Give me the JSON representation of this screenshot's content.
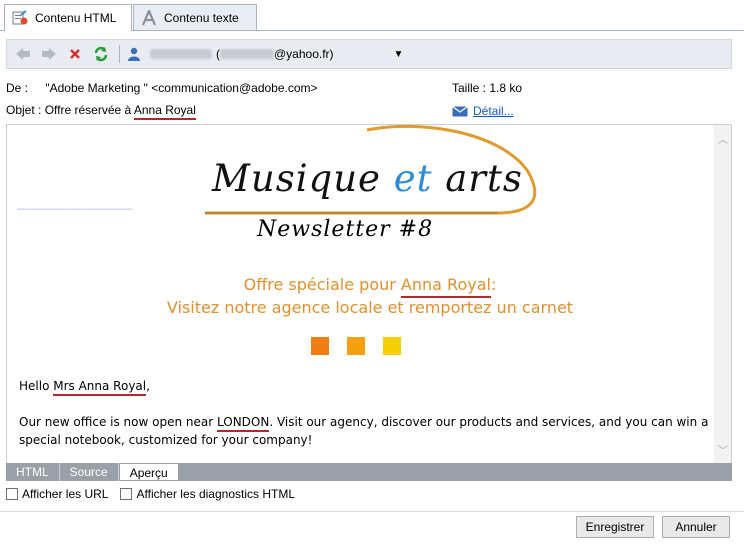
{
  "tabs": [
    {
      "label": "Contenu HTML",
      "icon": "html-content-icon"
    },
    {
      "label": "Contenu texte",
      "icon": "text-content-icon"
    }
  ],
  "toolbar": {
    "recipient_suffix": "@yahoo.fr)",
    "recipient_paren": "("
  },
  "header": {
    "from_label": "De :",
    "from_value": "\"Adobe Marketing \" <communication@adobe.com>",
    "subject_label": "Objet :",
    "subject_prefix": "Offre réservée à ",
    "subject_name": "Anna Royal",
    "size_label": "Taille :",
    "size_value": "1.8 ko",
    "detail_link": "Détail..."
  },
  "preview": {
    "title_part1": "Musique ",
    "title_part2": "et",
    "title_part3": " arts",
    "newsletter": "Newsletter #8",
    "offer_prefix": "Offre spéciale pour ",
    "offer_name": "Anna Royal",
    "offer_colon": ":",
    "offer_line2": "Visitez notre agence locale et remportez un carnet",
    "squares": [
      "#f07f13",
      "#f4a010",
      "#f5cf00"
    ],
    "greeting_prefix": "Hello ",
    "greeting_name": "Mrs Anna Royal",
    "greeting_suffix": ",",
    "para_prefix": "Our new office is now open near ",
    "para_city": "LONDON",
    "para_suffix": ". Visit our agency, discover our products and services, and you can win a",
    "para_line2": "special notebook, customized for your company!"
  },
  "bottom_tabs": [
    "HTML",
    "Source",
    "Aperçu"
  ],
  "checkboxes": [
    "Afficher les URL",
    "Afficher les diagnostics HTML"
  ],
  "buttons": {
    "save": "Enregistrer",
    "cancel": "Annuler"
  },
  "colors": {
    "accent_orange": "#e0902e",
    "underline_red": "#b2282d",
    "link_blue": "#1a56c4"
  }
}
